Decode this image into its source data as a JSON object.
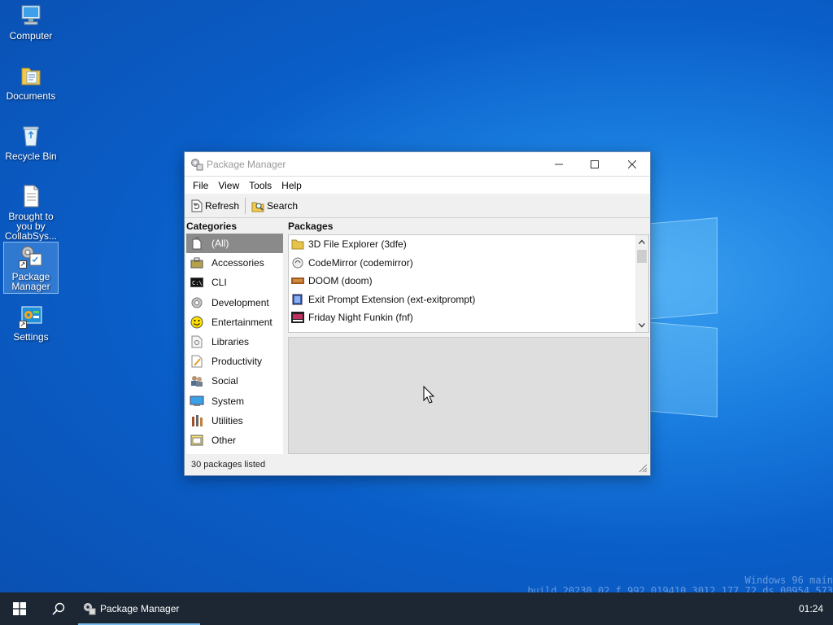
{
  "desktop": {
    "icons": [
      {
        "label": "Computer"
      },
      {
        "label": "Documents"
      },
      {
        "label": "Recycle Bin"
      },
      {
        "label": "Brought to you by CollabSys..."
      },
      {
        "label": "Package Manager"
      },
      {
        "label": "Settings"
      }
    ],
    "watermark_line1": "Windows 96 main",
    "watermark_line2": "build 20230 02 f 992 019410 3012 177 72 ds 00954 573"
  },
  "window": {
    "title": "Package Manager",
    "menu": [
      "File",
      "View",
      "Tools",
      "Help"
    ],
    "toolbar": {
      "refresh_label": "Refresh",
      "search_label": "Search"
    },
    "categories_header": "Categories",
    "packages_header": "Packages",
    "categories": [
      {
        "label": "(All)",
        "icon": "all-icon",
        "selected": true
      },
      {
        "label": "Accessories",
        "icon": "accessories-icon"
      },
      {
        "label": "CLI",
        "icon": "cli-icon"
      },
      {
        "label": "Development",
        "icon": "development-icon"
      },
      {
        "label": "Entertainment",
        "icon": "entertainment-icon"
      },
      {
        "label": "Libraries",
        "icon": "libraries-icon"
      },
      {
        "label": "Productivity",
        "icon": "productivity-icon"
      },
      {
        "label": "Social",
        "icon": "social-icon"
      },
      {
        "label": "System",
        "icon": "system-icon"
      },
      {
        "label": "Utilities",
        "icon": "utilities-icon"
      },
      {
        "label": "Other",
        "icon": "other-icon"
      }
    ],
    "packages": [
      {
        "label": "3D File Explorer (3dfe)",
        "icon": "folder-icon"
      },
      {
        "label": "CodeMirror (codemirror)",
        "icon": "codemirror-icon"
      },
      {
        "label": "DOOM (doom)",
        "icon": "doom-icon"
      },
      {
        "label": "Exit Prompt Extension (ext-exitprompt)",
        "icon": "extension-icon"
      },
      {
        "label": "Friday Night Funkin (fnf)",
        "icon": "fnf-icon"
      }
    ],
    "status": "30 packages listed"
  },
  "taskbar": {
    "task_label": "Package Manager",
    "clock": "01:24"
  },
  "colors": {
    "selection_gray": "#8a8a8a",
    "taskbar": "#1c2733",
    "task_underline": "#76b9ed"
  }
}
